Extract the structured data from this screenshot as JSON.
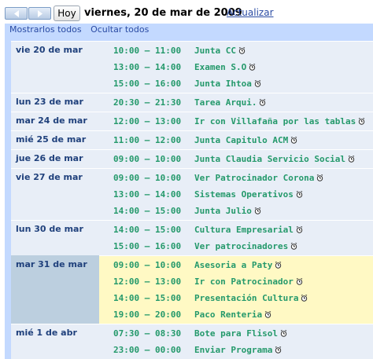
{
  "toolbar": {
    "prev_icon": "chevron-left-icon",
    "next_icon": "chevron-right-icon",
    "today_label": "Hoy",
    "date_title": "viernes, 20 de mar de 2009",
    "refresh_label": "Actualizar"
  },
  "actions": {
    "show_all": "Mostrarlos todos",
    "hide_all": "Ocultar todos"
  },
  "colors": {
    "day_label": "#20417c",
    "event_text": "#24996b",
    "row_background": "#e8eef7",
    "today_background": "#fff9c4",
    "today_day_cell": "#bccfdf",
    "frame": "#c3d9ff"
  },
  "days": [
    {
      "label": "vie 20 de mar",
      "events": [
        {
          "time": "10:00 – 11:00",
          "title": "Junta CC"
        },
        {
          "time": "13:00 – 14:00",
          "title": "Examen S.O"
        },
        {
          "time": "15:00 – 16:00",
          "title": "Junta Ihtoa"
        }
      ]
    },
    {
      "label": "lun 23 de mar",
      "events": [
        {
          "time": "20:30 – 21:30",
          "title": "Tarea Arqui."
        }
      ]
    },
    {
      "label": "mar 24 de mar",
      "events": [
        {
          "time": "12:00 – 13:00",
          "title": "Ir con Villafaña por las tablas"
        }
      ]
    },
    {
      "label": "mié 25 de mar",
      "events": [
        {
          "time": "11:00 – 12:00",
          "title": "Junta Capitulo ACM"
        }
      ]
    },
    {
      "label": "jue 26 de mar",
      "events": [
        {
          "time": "09:00 – 10:00",
          "title": "Junta Claudia Servicio Social"
        }
      ]
    },
    {
      "label": "vie 27 de mar",
      "events": [
        {
          "time": "09:00 – 10:00",
          "title": "Ver Patrocinador Corona"
        },
        {
          "time": "13:00 – 14:00",
          "title": "Sistemas Operativos"
        },
        {
          "time": "14:00 – 15:00",
          "title": "Junta Julio"
        }
      ]
    },
    {
      "label": "lun 30 de mar",
      "events": [
        {
          "time": "14:00 – 15:00",
          "title": "Cultura Empresarial"
        },
        {
          "time": "15:00 – 16:00",
          "title": "Ver patrocinadores"
        }
      ]
    },
    {
      "label": "mar 31 de mar",
      "today": true,
      "events": [
        {
          "time": "09:00 – 10:00",
          "title": "Asesoria a Paty"
        },
        {
          "time": "12:00 – 13:00",
          "title": "Ir con Patrocinador"
        },
        {
          "time": "14:00 – 15:00",
          "title": "Presentación Cultura"
        },
        {
          "time": "19:00 – 20:00",
          "title": "Paco Renteria"
        }
      ]
    },
    {
      "label": "mié 1 de abr",
      "events": [
        {
          "time": "07:30 – 08:30",
          "title": "Bote para Flisol"
        },
        {
          "time": "23:00 – 00:00",
          "title": "Enviar Programa"
        }
      ]
    }
  ]
}
